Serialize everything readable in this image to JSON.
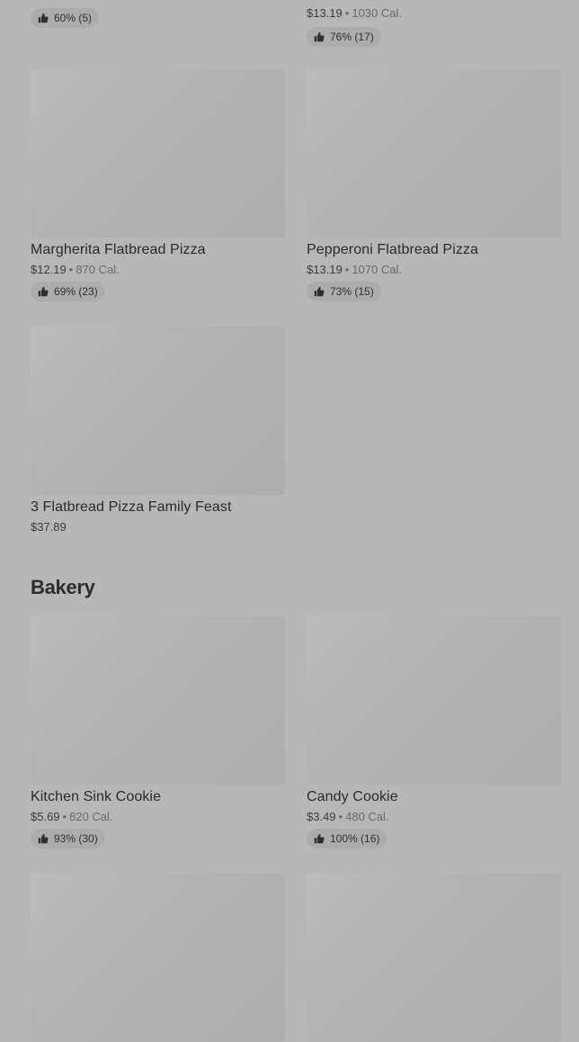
{
  "top_row": {
    "left": {
      "rating": "60% (5)"
    },
    "right": {
      "price": "$13.19",
      "calories": "1030 Cal.",
      "rating": "76% (17)"
    }
  },
  "flatbread_items": [
    {
      "name": "Margherita Flatbread Pizza",
      "price": "$12.19",
      "calories": "870 Cal.",
      "rating": "69% (23)"
    },
    {
      "name": "Pepperoni Flatbread Pizza",
      "price": "$13.19",
      "calories": "1070 Cal.",
      "rating": "73% (15)"
    },
    {
      "name": "3 Flatbread Pizza Family Feast",
      "price": "$37.89"
    }
  ],
  "bakery": {
    "title": "Bakery",
    "items": [
      {
        "name": "Kitchen Sink Cookie",
        "price": "$5.69",
        "calories": "820 Cal.",
        "rating": "93% (30)"
      },
      {
        "name": "Candy Cookie",
        "price": "$3.49",
        "calories": "480 Cal.",
        "rating": "100% (16)"
      }
    ]
  },
  "icons": {
    "rating": "thumbs-up-icon"
  },
  "colors": {
    "overlay": "#b7b7b7",
    "text": "#2d2d2d",
    "muted": "#6a6a6a"
  }
}
